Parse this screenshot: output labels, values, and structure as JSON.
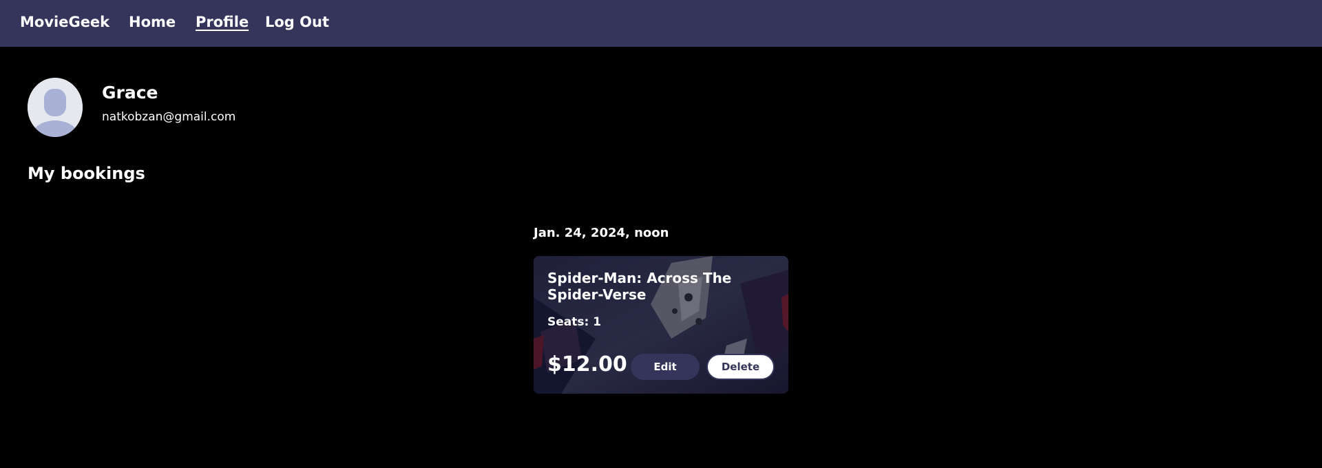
{
  "nav": {
    "brand": "MovieGeek",
    "links": [
      {
        "label": "Home"
      },
      {
        "label": "Profile"
      },
      {
        "label": "Log Out"
      }
    ]
  },
  "colors": {
    "navbar_bg": "#35345a",
    "page_bg": "#000000",
    "edit_button_bg": "#35345a",
    "delete_button_bg": "#ffffff"
  },
  "profile": {
    "avatar_icon": "user-silhouette-icon",
    "name": "Grace",
    "email": "natkobzan@gmail.com"
  },
  "bookings": {
    "title": "My bookings",
    "items": [
      {
        "date": "Jan. 24, 2024, noon",
        "movie_title": "Spider-Man: Across The Spider-Verse",
        "seats_label": "Seats:",
        "seats": "1",
        "price": "$12.00",
        "edit_label": "Edit",
        "delete_label": "Delete"
      }
    ]
  }
}
